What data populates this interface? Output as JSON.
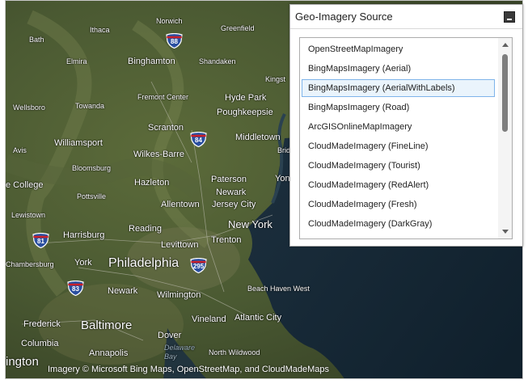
{
  "panel": {
    "title": "Geo-Imagery Source",
    "collapse_icon": "minimize-icon",
    "items": [
      {
        "label": "OpenStreetMapImagery",
        "selected": false
      },
      {
        "label": "BingMapsImagery (Aerial)",
        "selected": false
      },
      {
        "label": "BingMapsImagery (AerialWithLabels)",
        "selected": true
      },
      {
        "label": "BingMapsImagery (Road)",
        "selected": false
      },
      {
        "label": "ArcGISOnlineMapImagery",
        "selected": false
      },
      {
        "label": "CloudMadeImagery (FineLine)",
        "selected": false
      },
      {
        "label": "CloudMadeImagery (Tourist)",
        "selected": false
      },
      {
        "label": "CloudMadeImagery (RedAlert)",
        "selected": false
      },
      {
        "label": "CloudMadeImagery (Fresh)",
        "selected": false
      },
      {
        "label": "CloudMadeImagery (DarkGray)",
        "selected": false
      }
    ],
    "scroll_up_icon": "scroll-up-arrow-icon",
    "scroll_down_icon": "scroll-down-arrow-icon"
  },
  "map": {
    "attribution": "Imagery © Microsoft Bing Maps, OpenStreetMap, and CloudMadeMaps",
    "places": {
      "bath": "Bath",
      "ithaca": "Ithaca",
      "norwich": "Norwich",
      "greenfield": "Greenfield",
      "elmira": "Elmira",
      "binghamton": "Binghamton",
      "shandaken": "Shandaken",
      "kingston": "Kingst",
      "fremont_center": "Fremont Center",
      "hyde_park": "Hyde Park",
      "wellsboro": "Wellsboro",
      "towanda": "Towanda",
      "poughkeepsie": "Poughkeepsie",
      "scranton": "Scranton",
      "middletown": "Middletown",
      "williamsport": "Williamsport",
      "avis": "Avis",
      "wilkes_barre": "Wilkes-Barre",
      "brid": "Brid",
      "bloomsburg": "Bloomsburg",
      "hazleton": "Hazleton",
      "paterson": "Paterson",
      "yon": "Yon",
      "state_college": "e College",
      "pottsville": "Pottsville",
      "newark_north": "Newark",
      "allentown": "Allentown",
      "jersey_city": "Jersey City",
      "lewistown": "Lewistown",
      "reading": "Reading",
      "new_york": "New York",
      "harrisburg": "Harrisburg",
      "trenton": "Trenton",
      "levittown": "Levittown",
      "chambersburg": "Chambersburg",
      "york": "York",
      "philadelphia": "Philadelphia",
      "newark_south": "Newark",
      "wilmington": "Wilmington",
      "beach_haven_west": "Beach Haven West",
      "vineland": "Vineland",
      "atlantic_city": "Atlantic City",
      "frederick": "Frederick",
      "baltimore": "Baltimore",
      "dover": "Dover",
      "columbia": "Columbia",
      "delaware_bay": "Delaware\nBay",
      "annapolis": "Annapolis",
      "north_wildwood": "North Wildwood",
      "washington": "ington"
    },
    "shields": {
      "i88": "88",
      "i84": "84",
      "i81": "81",
      "i295": "295",
      "i83": "83"
    }
  }
}
